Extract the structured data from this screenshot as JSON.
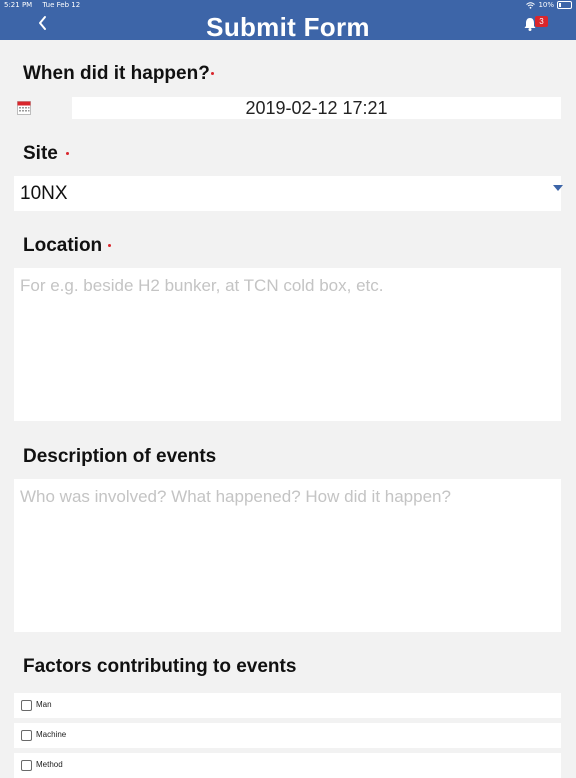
{
  "status_bar": {
    "time": "5:21 PM",
    "date": "Tue Feb 12",
    "battery": "10%"
  },
  "nav": {
    "title": "Submit Form",
    "back_icon": "chevron-left-icon",
    "bell_icon": "bell-icon",
    "notification_count": "3"
  },
  "colors": {
    "header": "#3d65a8",
    "required_dot": "#d9262c",
    "badge": "#d9262c"
  },
  "form": {
    "when": {
      "label": "When did it happen?",
      "value": "2019-02-12 17:21",
      "icon": "calendar-icon"
    },
    "site": {
      "label": "Site",
      "value": "10NX"
    },
    "location": {
      "label": "Location",
      "placeholder": "For e.g. beside H2 bunker, at TCN cold box, etc."
    },
    "description": {
      "label": "Description of events",
      "placeholder": "Who was involved? What happened? How did it happen?"
    },
    "factors": {
      "label": "Factors contributing to events",
      "options": [
        "Man",
        "Machine",
        "Method"
      ]
    }
  }
}
